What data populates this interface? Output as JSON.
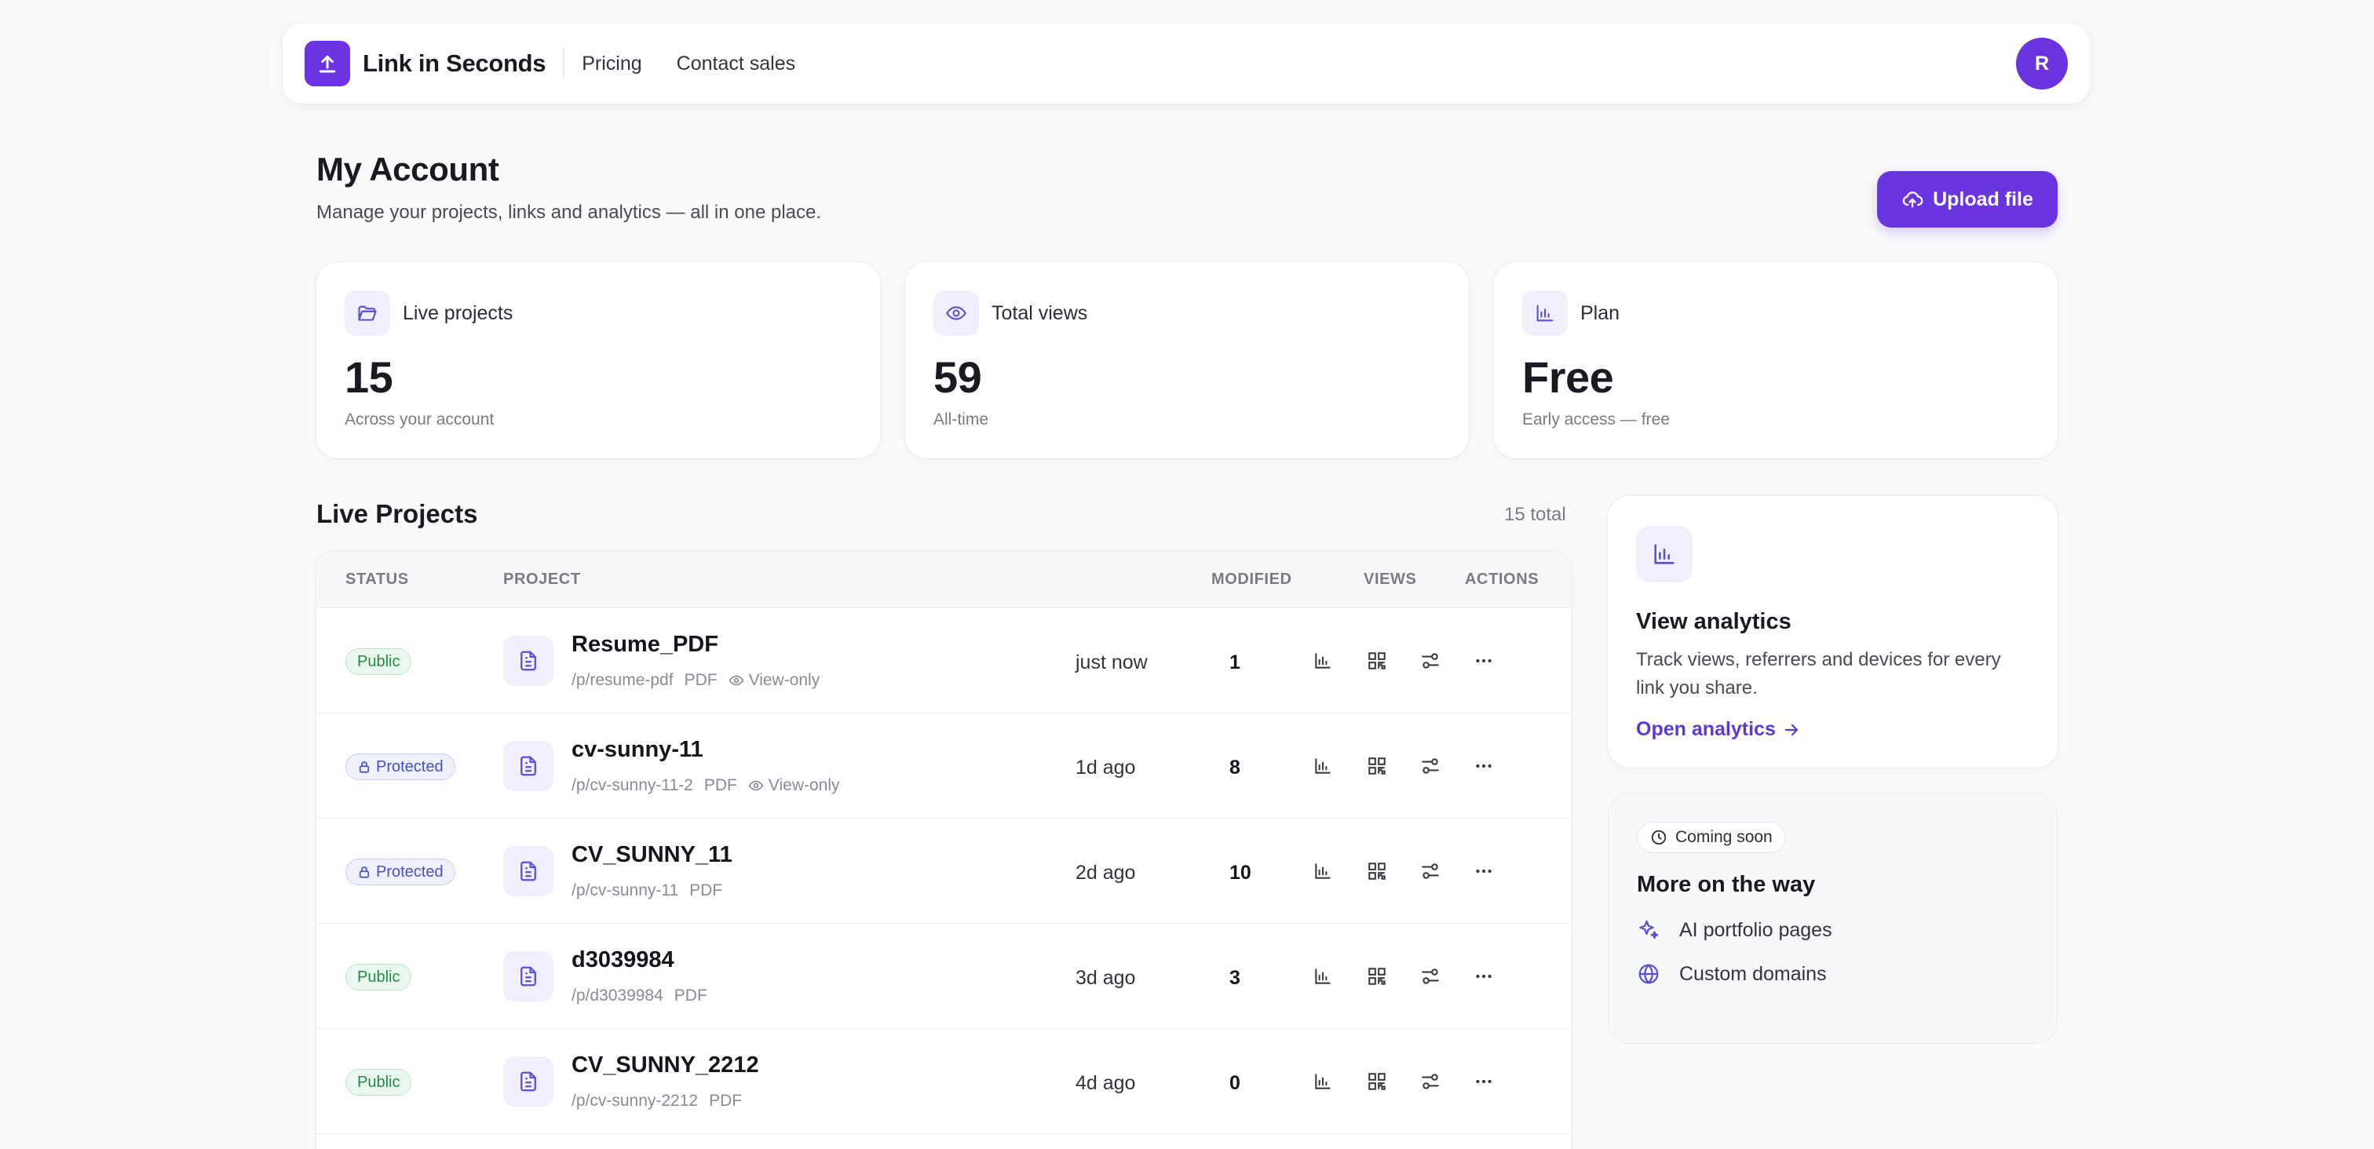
{
  "nav": {
    "brand": "Link in Seconds",
    "links": [
      "Pricing",
      "Contact sales"
    ],
    "avatar_initial": "R"
  },
  "header": {
    "title": "My Account",
    "subtitle": "Manage your projects, links and analytics — all in one place.",
    "upload_label": "Upload file"
  },
  "stats": [
    {
      "label": "Live projects",
      "value": "15",
      "note": "Across your account",
      "icon": "folder-icon"
    },
    {
      "label": "Total views",
      "value": "59",
      "note": "All-time",
      "icon": "eye-icon"
    },
    {
      "label": "Plan",
      "value": "Free",
      "note": "Early access — free",
      "icon": "bar-chart-icon"
    }
  ],
  "projects": {
    "title": "Live Projects",
    "count": "15 total",
    "columns": {
      "status": "STATUS",
      "project": "PROJECT",
      "modified": "MODIFIED",
      "views": "VIEWS",
      "actions": "ACTIONS"
    },
    "rows": [
      {
        "status": "Public",
        "name": "Resume_PDF",
        "path": "/p/resume-pdf",
        "type": "PDF",
        "extra": "View-only",
        "modified": "just now",
        "views": "1"
      },
      {
        "status": "Protected",
        "name": "cv-sunny-11",
        "path": "/p/cv-sunny-11-2",
        "type": "PDF",
        "extra": "View-only",
        "modified": "1d ago",
        "views": "8"
      },
      {
        "status": "Protected",
        "name": "CV_SUNNY_11",
        "path": "/p/cv-sunny-11",
        "type": "PDF",
        "extra": "",
        "modified": "2d ago",
        "views": "10"
      },
      {
        "status": "Public",
        "name": "d3039984",
        "path": "/p/d3039984",
        "type": "PDF",
        "extra": "",
        "modified": "3d ago",
        "views": "3"
      },
      {
        "status": "Public",
        "name": "CV_SUNNY_2212",
        "path": "/p/cv-sunny-2212",
        "type": "PDF",
        "extra": "",
        "modified": "4d ago",
        "views": "0"
      }
    ]
  },
  "analytics": {
    "title": "View analytics",
    "description": "Track views, referrers and devices for every link you share.",
    "link": "Open analytics"
  },
  "coming_soon": {
    "pill": "Coming soon",
    "title": "More on the way",
    "items": [
      "AI portfolio pages",
      "Custom domains"
    ]
  },
  "colors": {
    "accent": "#6a35e0",
    "public": "#208a48",
    "protected": "#4a4fc4"
  }
}
